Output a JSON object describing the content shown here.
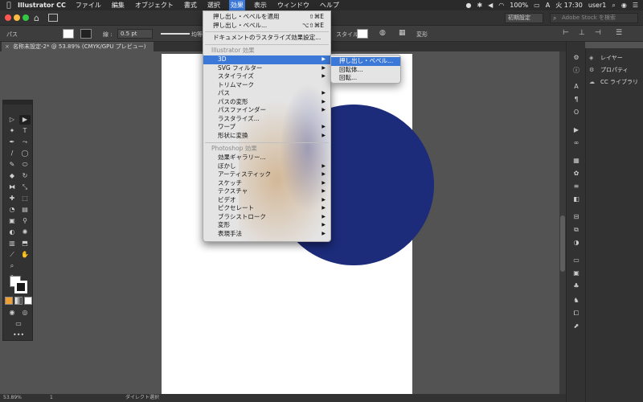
{
  "menubar": {
    "app_name": "Illustrator CC",
    "items": [
      "ファイル",
      "編集",
      "オブジェクト",
      "書式",
      "選択",
      "効果",
      "表示",
      "ウィンドウ",
      "ヘルプ"
    ],
    "battery": "100%",
    "input_mode": "A",
    "time": "火 17:30",
    "user": "user1"
  },
  "appbar": {
    "workspace": "初期設定",
    "search_placeholder": "Adobe Stock を検索"
  },
  "controlbar": {
    "path_label": "パス",
    "stroke_label": "線 :",
    "stroke_weight": "0.5 pt",
    "stroke_profile": "均等",
    "style_label": "スタイル :",
    "transform_label": "変形"
  },
  "document": {
    "tab_title": "名称未設定-2* @ 53.89% (CMYK/GPU プレビュー)"
  },
  "menu": {
    "items": [
      {
        "label": "押し出し・ベベルを適用",
        "shortcut": "⇧⌘E"
      },
      {
        "label": "押し出し・ベベル...",
        "shortcut": "⌥⇧⌘E"
      },
      {
        "label": "ドキュメントのラスタライズ効果設定..."
      },
      {
        "label": "Illustrator 効果"
      },
      {
        "label": "3D"
      },
      {
        "label": "SVG フィルター"
      },
      {
        "label": "スタイライズ"
      },
      {
        "label": "トリムマーク"
      },
      {
        "label": "パス"
      },
      {
        "label": "パスの変形"
      },
      {
        "label": "パスファインダー"
      },
      {
        "label": "ラスタライズ..."
      },
      {
        "label": "ワープ"
      },
      {
        "label": "形状に変換"
      },
      {
        "label": "Photoshop 効果"
      },
      {
        "label": "効果ギャラリー..."
      },
      {
        "label": "ぼかし"
      },
      {
        "label": "アーティスティック"
      },
      {
        "label": "スケッチ"
      },
      {
        "label": "テクスチャ"
      },
      {
        "label": "ビデオ"
      },
      {
        "label": "ピクセレート"
      },
      {
        "label": "ブラシストローク"
      },
      {
        "label": "変形"
      },
      {
        "label": "表現手法"
      }
    ]
  },
  "submenu": {
    "items": [
      "押し出し・ベベル...",
      "回転体...",
      "回転..."
    ]
  },
  "right_panel": {
    "items": [
      "レイヤー",
      "プロパティ",
      "CC ライブラリ"
    ]
  },
  "statusbar": {
    "zoom": "53.89%",
    "page": "1",
    "tool": "ダイレクト選択"
  },
  "colors": {
    "accent": "#3b78d8",
    "artwork_circle": "#1c2b7a"
  }
}
